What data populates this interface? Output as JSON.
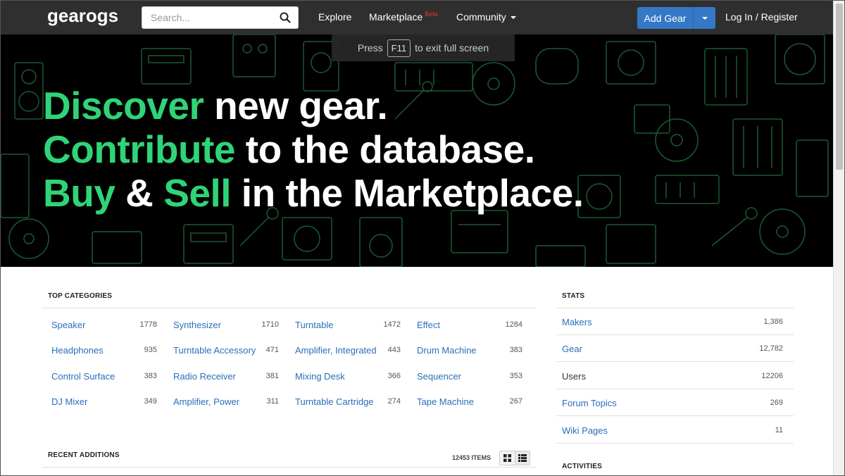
{
  "nav": {
    "logo_text": "gearogs",
    "search_placeholder": "Search...",
    "explore": "Explore",
    "marketplace": "Marketplace",
    "marketplace_badge": "Beta",
    "community": "Community",
    "add_gear": "Add Gear",
    "login": "Log In / Register"
  },
  "fullscreen_tip": {
    "press": "Press",
    "key": "F11",
    "rest": "to exit full screen"
  },
  "hero": {
    "line1_accent": "Discover",
    "line1_rest": " new gear.",
    "line2_accent": "Contribute",
    "line2_rest": " to the database.",
    "line3_accent1": "Buy",
    "line3_mid": " & ",
    "line3_accent2": "Sell",
    "line3_rest": " in the Marketplace.",
    "accent_color": "#2fd477"
  },
  "top_categories": {
    "title": "TOP CATEGORIES",
    "items": [
      {
        "name": "Speaker",
        "count": "1778"
      },
      {
        "name": "Synthesizer",
        "count": "1710"
      },
      {
        "name": "Turntable",
        "count": "1472"
      },
      {
        "name": "Effect",
        "count": "1284"
      },
      {
        "name": "Headphones",
        "count": "935"
      },
      {
        "name": "Turntable Accessory",
        "count": "471"
      },
      {
        "name": "Amplifier, Integrated",
        "count": "443"
      },
      {
        "name": "Drum Machine",
        "count": "383"
      },
      {
        "name": "Control Surface",
        "count": "383"
      },
      {
        "name": "Radio Receiver",
        "count": "381"
      },
      {
        "name": "Mixing Desk",
        "count": "366"
      },
      {
        "name": "Sequencer",
        "count": "353"
      },
      {
        "name": "DJ Mixer",
        "count": "349"
      },
      {
        "name": "Amplifier, Power",
        "count": "311"
      },
      {
        "name": "Turntable Cartridge",
        "count": "274"
      },
      {
        "name": "Tape Machine",
        "count": "267"
      }
    ]
  },
  "stats": {
    "title": "STATS",
    "rows": [
      {
        "label": "Makers",
        "value": "1,386",
        "link": true
      },
      {
        "label": "Gear",
        "value": "12,782",
        "link": true
      },
      {
        "label": "Users",
        "value": "12206",
        "link": false
      },
      {
        "label": "Forum Topics",
        "value": "269",
        "link": true
      },
      {
        "label": "Wiki Pages",
        "value": "11",
        "link": true
      }
    ]
  },
  "recent": {
    "title": "RECENT ADDITIONS",
    "items_count": "12453 ITEMS"
  },
  "activities": {
    "title": "ACTIVITIES"
  }
}
